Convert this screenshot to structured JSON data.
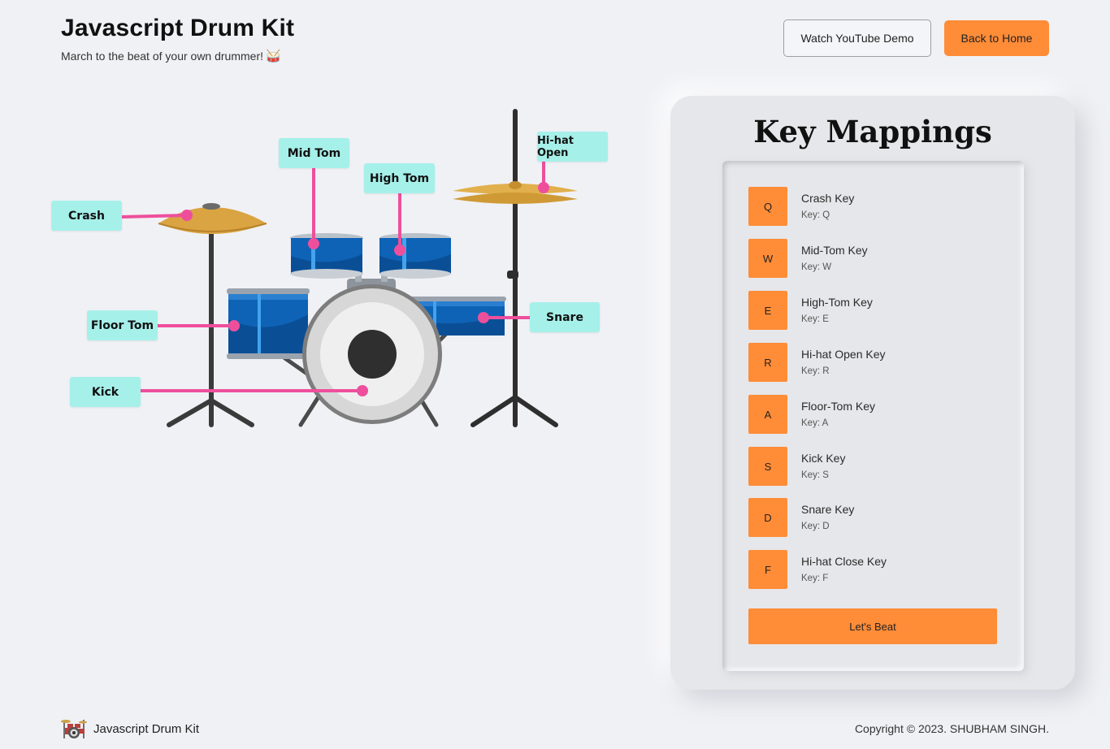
{
  "header": {
    "title": "Javascript Drum Kit",
    "subtitle": "March to the beat of your own drummer!",
    "subtitle_emoji": "🥁",
    "demo_button": "Watch YouTube Demo",
    "home_button": "Back to Home"
  },
  "kit": {
    "labels": {
      "crash": "Crash",
      "mid_tom": "Mid Tom",
      "high_tom": "High Tom",
      "hihat_open": "Hi-hat Open",
      "floor_tom": "Floor Tom",
      "snare": "Snare",
      "kick": "Kick"
    },
    "colors": {
      "label_bg": "#a6f0ea",
      "pointer": "#ee4f9c",
      "drum_blue": "#0e63b6",
      "cymbal": "#d9a441"
    }
  },
  "panel": {
    "title": "Key Mappings",
    "mappings": [
      {
        "key": "Q",
        "name": "Crash Key",
        "sub": "Key: Q"
      },
      {
        "key": "W",
        "name": "Mid-Tom Key",
        "sub": "Key: W"
      },
      {
        "key": "E",
        "name": "High-Tom Key",
        "sub": "Key: E"
      },
      {
        "key": "R",
        "name": "Hi-hat Open Key",
        "sub": "Key: R"
      },
      {
        "key": "A",
        "name": "Floor-Tom Key",
        "sub": "Key: A"
      },
      {
        "key": "S",
        "name": "Kick Key",
        "sub": "Key: S"
      },
      {
        "key": "D",
        "name": "Snare Key",
        "sub": "Key: D"
      },
      {
        "key": "F",
        "name": "Hi-hat Close Key",
        "sub": "Key: F"
      }
    ],
    "beat_button": "Let's Beat",
    "accent": "#ff8c37"
  },
  "footer": {
    "name": "Javascript Drum Kit",
    "copyright": "Copyright © 2023. SHUBHAM SINGH."
  }
}
